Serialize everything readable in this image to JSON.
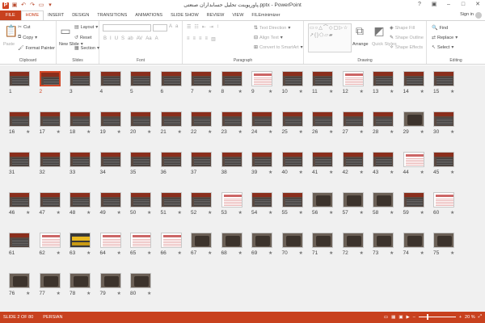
{
  "window": {
    "title": "پاورپوینت تحلیل حسابداران صنعتی.pptx - PowerPoint",
    "signin": "Sign in"
  },
  "tabs": [
    "FILE",
    "HOME",
    "INSERT",
    "DESIGN",
    "TRANSITIONS",
    "ANIMATIONS",
    "SLIDE SHOW",
    "REVIEW",
    "VIEW",
    "FILEminimizer"
  ],
  "active_tab": "HOME",
  "ribbon": {
    "clipboard": {
      "paste": "Paste",
      "cut": "Cut",
      "copy": "Copy",
      "format_painter": "Format Painter",
      "label": "Clipboard"
    },
    "slides": {
      "new_slide": "New Slide",
      "layout": "Layout",
      "reset": "Reset",
      "section": "Section",
      "label": "Slides"
    },
    "font": {
      "label": "Font"
    },
    "paragraph": {
      "text_direction": "Text Direction",
      "align_text": "Align Text",
      "convert_smartart": "Convert to SmartArt",
      "label": "Paragraph"
    },
    "drawing": {
      "arrange": "Arrange",
      "quick_styles": "Quick Styles",
      "shape_fill": "Shape Fill",
      "shape_outline": "Shape Outline",
      "shape_effects": "Shape Effects",
      "label": "Drawing"
    },
    "editing": {
      "find": "Find",
      "replace": "Replace",
      "select": "Select",
      "label": "Editing"
    }
  },
  "slides": {
    "selected": 2,
    "light_slides": [
      9,
      12,
      44,
      53,
      60,
      62,
      64,
      65,
      66
    ],
    "image_slides": [
      29,
      56,
      57,
      58,
      67,
      68,
      69,
      70,
      71,
      72,
      73,
      74,
      75,
      76,
      77,
      78,
      79,
      80
    ],
    "yellow_slides": [
      63
    ],
    "no_star": [
      1,
      2,
      3,
      4,
      5,
      6,
      31,
      32,
      33,
      34,
      35,
      36,
      37,
      38,
      61
    ]
  },
  "status": {
    "slide_info": "SLIDE 2 OF 80",
    "language": "PERSIAN",
    "zoom": "20 %"
  }
}
